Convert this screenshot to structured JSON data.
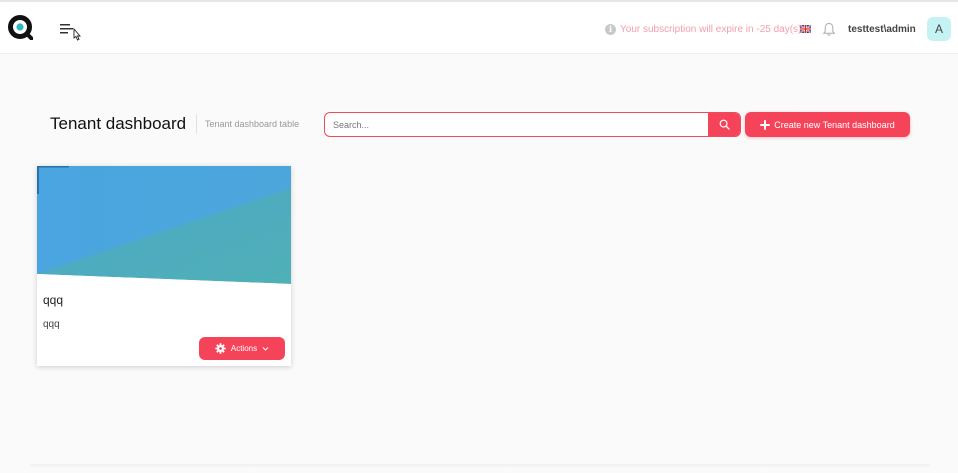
{
  "header": {
    "subscription_notice": "Your subscription will expire in -25 day(s)",
    "username": "testtest\\admin",
    "avatar_initial": "A"
  },
  "page": {
    "title": "Tenant dashboard",
    "subtitle": "Tenant dashboard table"
  },
  "search": {
    "placeholder": "Search...",
    "value": ""
  },
  "toolbar": {
    "create_label": "Create new Tenant dashboard"
  },
  "cards": [
    {
      "title": "qqq",
      "description": "qqq",
      "actions_label": "Actions"
    }
  ],
  "colors": {
    "accent": "#f5435a",
    "avatar_bg": "#c5f3f4",
    "notice_text": "#f3a0ac"
  },
  "icons": [
    "app-logo-icon",
    "hamburger-menu-icon",
    "info-icon",
    "uk-flag-icon",
    "bell-icon",
    "search-icon",
    "plus-icon",
    "gear-icon",
    "chevron-down-icon"
  ]
}
